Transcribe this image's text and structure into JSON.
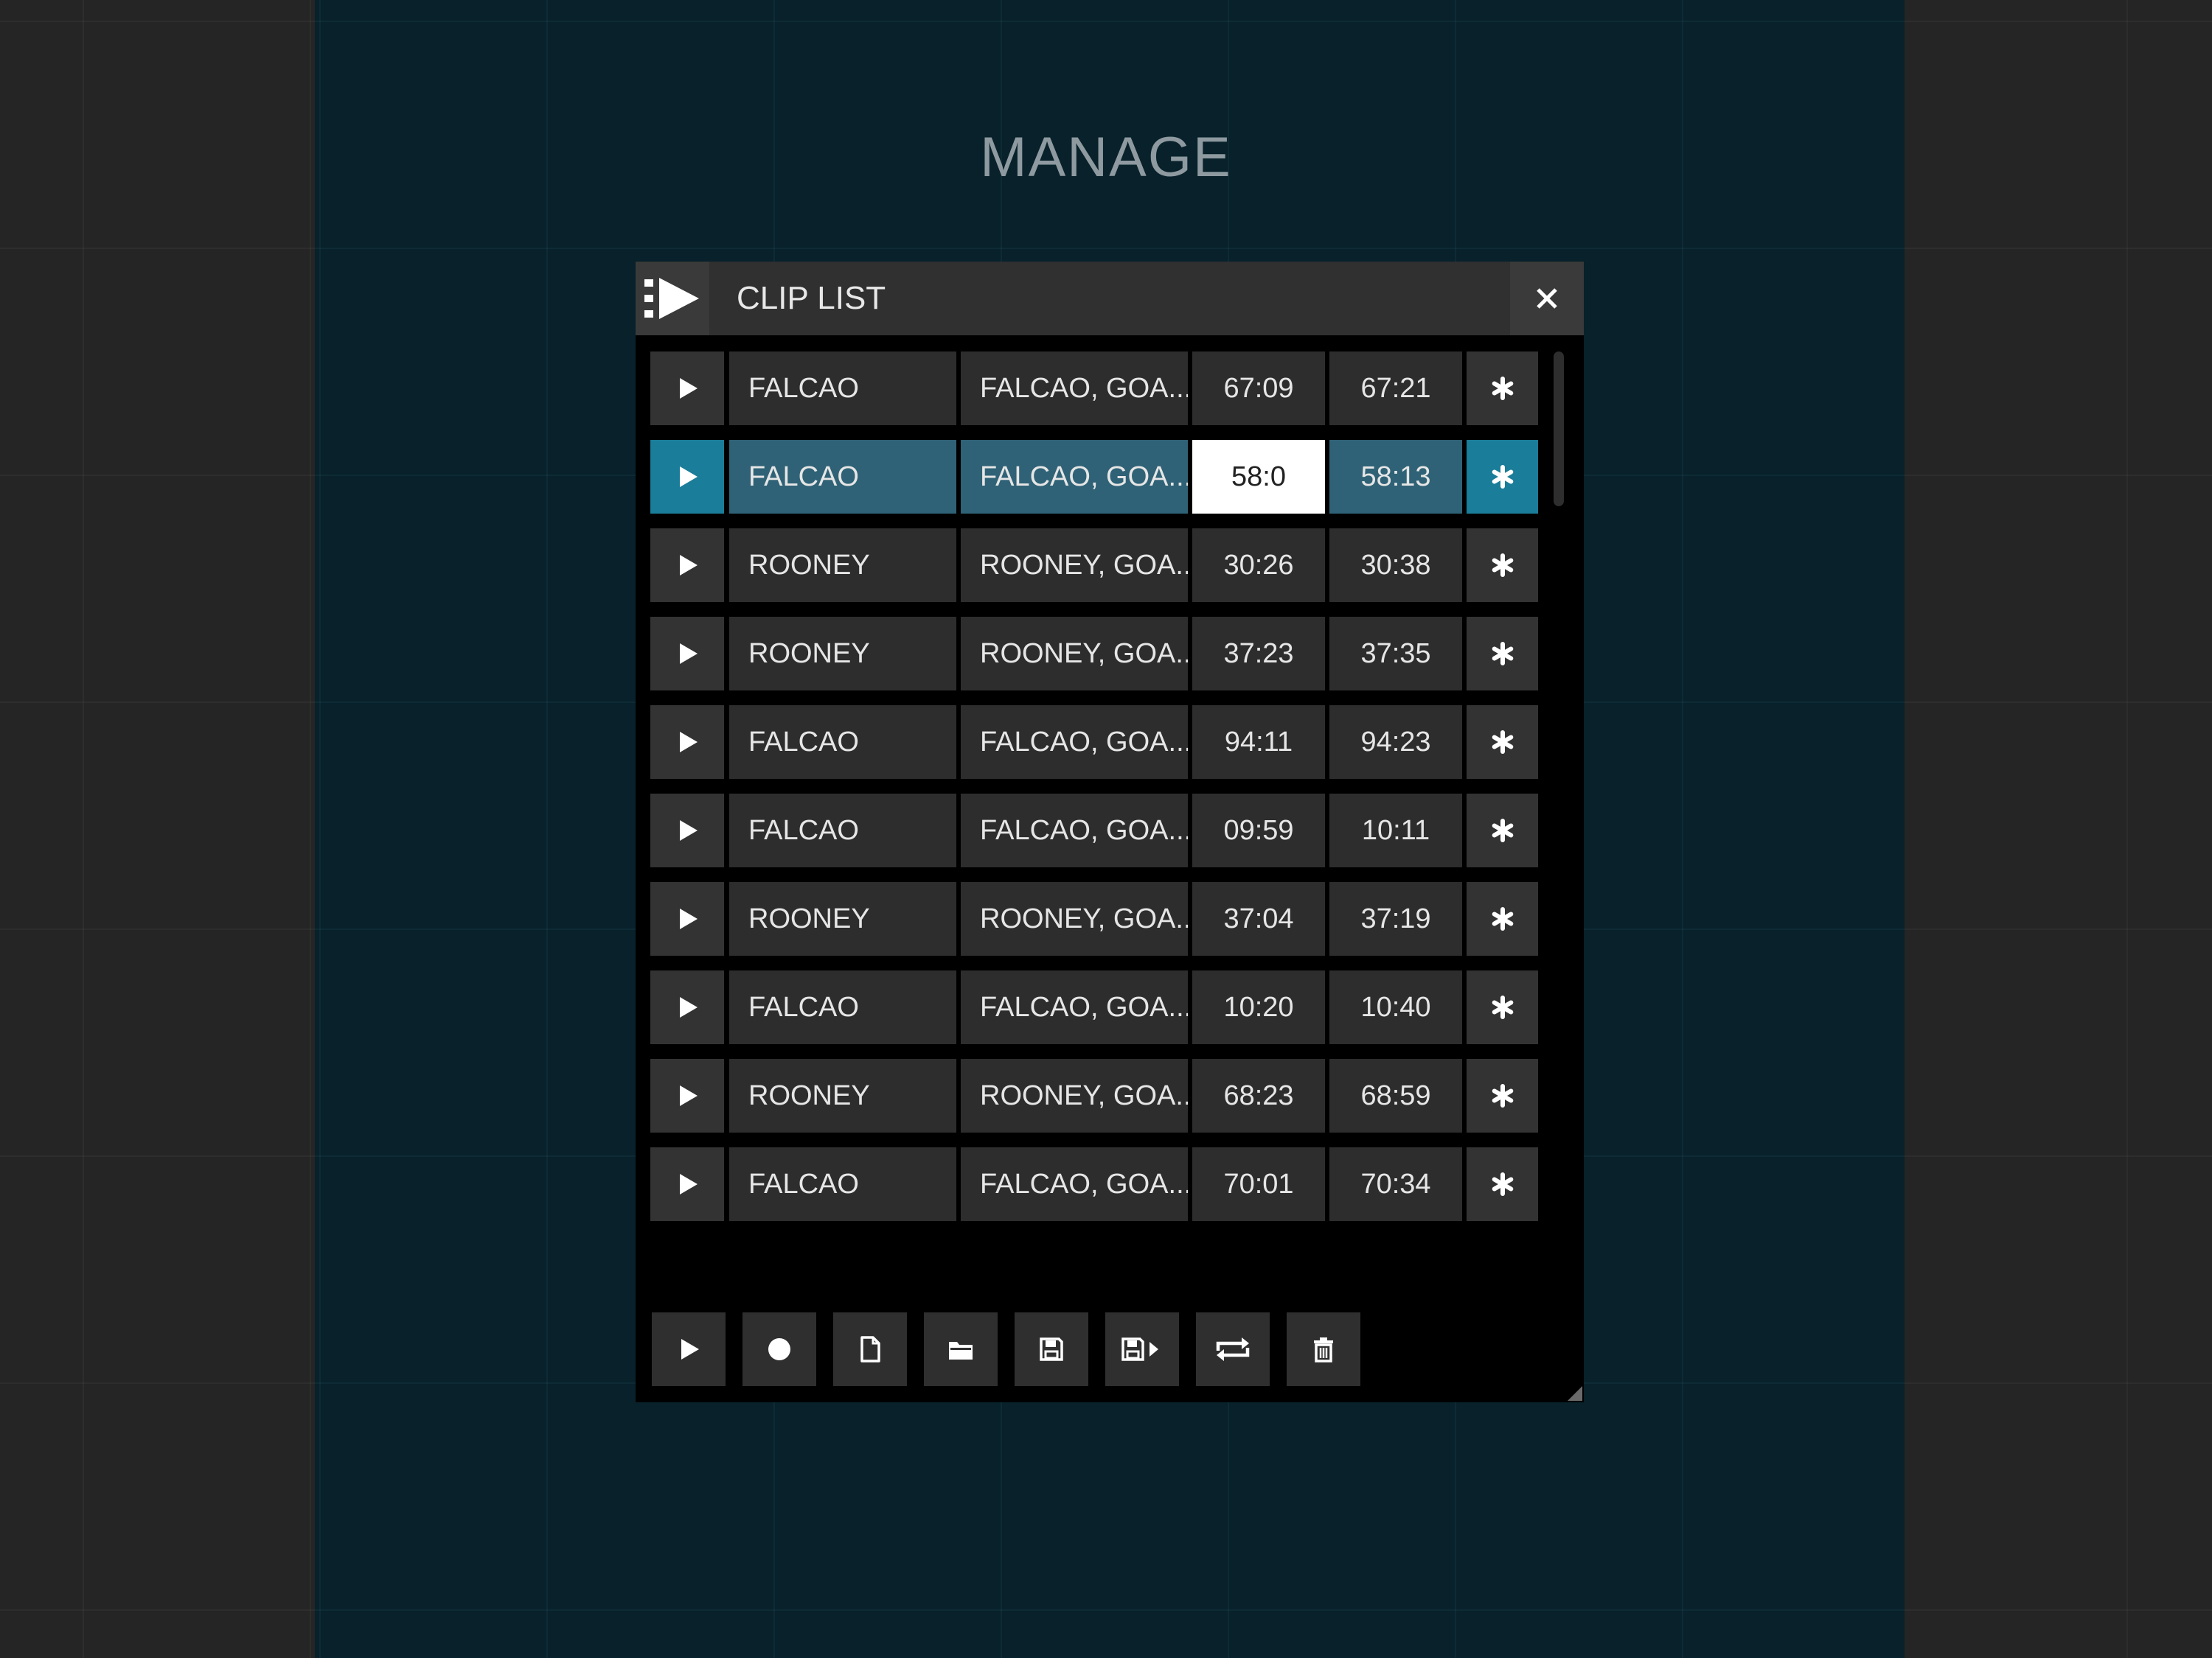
{
  "page": {
    "title": "MANAGE"
  },
  "window": {
    "title": "CLIP LIST",
    "logo_icon": "clip-list-play-icon",
    "close_icon": "close-icon"
  },
  "clips": [
    {
      "name": "FALCAO",
      "description": "FALCAO, GOA...",
      "in": "67:09",
      "out": "67:21",
      "selected": false
    },
    {
      "name": "FALCAO",
      "description": "FALCAO, GOA...",
      "in": "58:0",
      "out": "58:13",
      "selected": true
    },
    {
      "name": "ROONEY",
      "description": "ROONEY, GOA...",
      "in": "30:26",
      "out": "30:38",
      "selected": false
    },
    {
      "name": "ROONEY",
      "description": "ROONEY, GOA...",
      "in": "37:23",
      "out": "37:35",
      "selected": false
    },
    {
      "name": "FALCAO",
      "description": "FALCAO, GOA...",
      "in": "94:11",
      "out": "94:23",
      "selected": false
    },
    {
      "name": "FALCAO",
      "description": "FALCAO, GOA...",
      "in": "09:59",
      "out": "10:11",
      "selected": false
    },
    {
      "name": "ROONEY",
      "description": "ROONEY, GOA...",
      "in": "37:04",
      "out": "37:19",
      "selected": false
    },
    {
      "name": "FALCAO",
      "description": "FALCAO, GOA...",
      "in": "10:20",
      "out": "10:40",
      "selected": false
    },
    {
      "name": "ROONEY",
      "description": "ROONEY, GOA...",
      "in": "68:23",
      "out": "68:59",
      "selected": false
    },
    {
      "name": "FALCAO",
      "description": "FALCAO, GOA...",
      "in": "70:01",
      "out": "70:34",
      "selected": false
    }
  ],
  "toolbar": [
    {
      "icon": "play-icon"
    },
    {
      "icon": "record-icon"
    },
    {
      "icon": "new-file-icon"
    },
    {
      "icon": "open-folder-icon"
    },
    {
      "icon": "save-icon"
    },
    {
      "icon": "save-as-icon"
    },
    {
      "icon": "loop-icon"
    },
    {
      "icon": "trash-icon"
    }
  ],
  "colors": {
    "selected_accent": "#1a7d99",
    "selected_cell": "#2f6276",
    "panel_bg": "#08212a",
    "outer_bg": "#252525"
  }
}
